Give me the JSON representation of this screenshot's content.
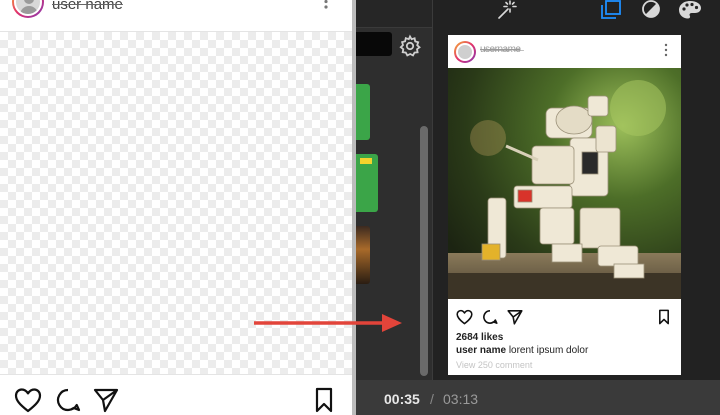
{
  "template_post": {
    "username": "user name",
    "more_icon": "vertical-ellipsis-icon",
    "action_icons": [
      "heart-icon",
      "comment-icon",
      "send-icon",
      "bookmark-icon"
    ]
  },
  "editor": {
    "toolbar_icons": [
      "magic-wand-icon",
      "layers-icon",
      "contrast-icon",
      "palette-icon"
    ],
    "settings_icon": "gear-icon"
  },
  "preview_post": {
    "username": "u̶s̶e̶r̶n̶a̶m̶e̶",
    "likes": "2684 likes",
    "caption_user": "user name",
    "caption_text": "lorent ipsum dolor",
    "comments": "View 250 comment"
  },
  "player": {
    "current_time": "00:35",
    "separator": "/",
    "total_time": "03:13"
  },
  "colors": {
    "accent_blue": "#1e90ff",
    "arrow_red": "#e2443a",
    "panel_dark": "#2b2b2b"
  }
}
